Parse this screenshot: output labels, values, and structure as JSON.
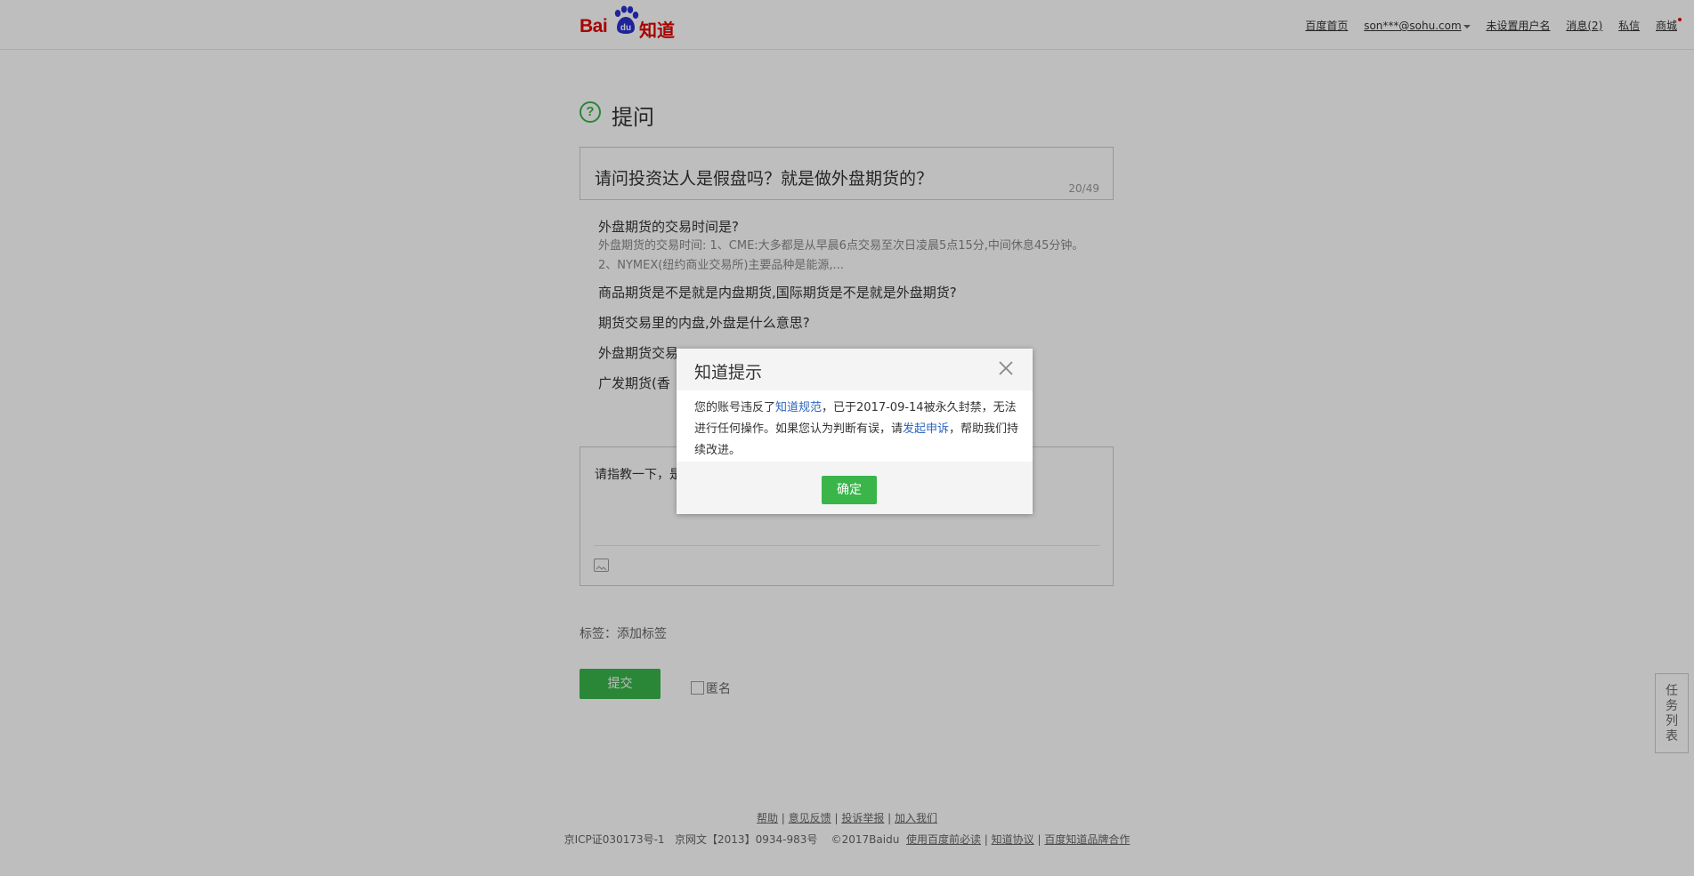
{
  "header": {
    "logo": {
      "bai": "Bai",
      "du": "du",
      "zhidao": "知道"
    },
    "nav": {
      "home": "百度首页",
      "account": "son***@sohu.com",
      "username": "未设置用户名",
      "messages": "消息(2)",
      "private": "私信",
      "mall": "商城"
    }
  },
  "ask": {
    "title": "提问",
    "question": "请问投资达人是假盘吗？就是做外盘期货的？",
    "char_count": "20/49"
  },
  "suggestions": {
    "first_title": "外盘期货的交易时间是?",
    "first_desc": "外盘期货的交易时间: 1、CME:大多都是从早晨6点交易至次日凌晨5点15分,中间休息45分钟。 2、NYMEX(纽约商业交易所)主要品种是能源,...",
    "items": [
      "商品期货是不是就是内盘期货,国际期货是不是就是外盘期货?",
      "期货交易里的内盘,外盘是什么意思?",
      "外盘期货交易",
      "广发期货(香"
    ]
  },
  "editor": {
    "placeholder": "请指教一下，是"
  },
  "tags": {
    "label": "标签：添加标签"
  },
  "submit": {
    "label": "提交"
  },
  "anonymous": {
    "label": "匿名"
  },
  "task_list": {
    "label": "任务列表"
  },
  "footer": {
    "links": [
      "帮助",
      "意见反馈",
      "投诉举报",
      "加入我们"
    ],
    "icp": "京ICP证030173号-1",
    "netculture": "京网文【2013】0934-983号",
    "copyright": "©2017Baidu",
    "links2": [
      "使用百度前必读",
      "知道协议",
      "百度知道品牌合作"
    ]
  },
  "dialog": {
    "title": "知道提示",
    "msg_part1": "您的账号违反了",
    "link1": "知道规范",
    "msg_part2": "，已于2017-09-14被永久封禁，无法进行任何操作。如果您认为判断有误，请",
    "link2": "发起申诉",
    "msg_part3": "，帮助我们持续改进。",
    "ok": "确定"
  },
  "colors": {
    "brand_red": "#e10602",
    "accent_green": "#39b54a",
    "link_blue": "#2c66c0"
  }
}
